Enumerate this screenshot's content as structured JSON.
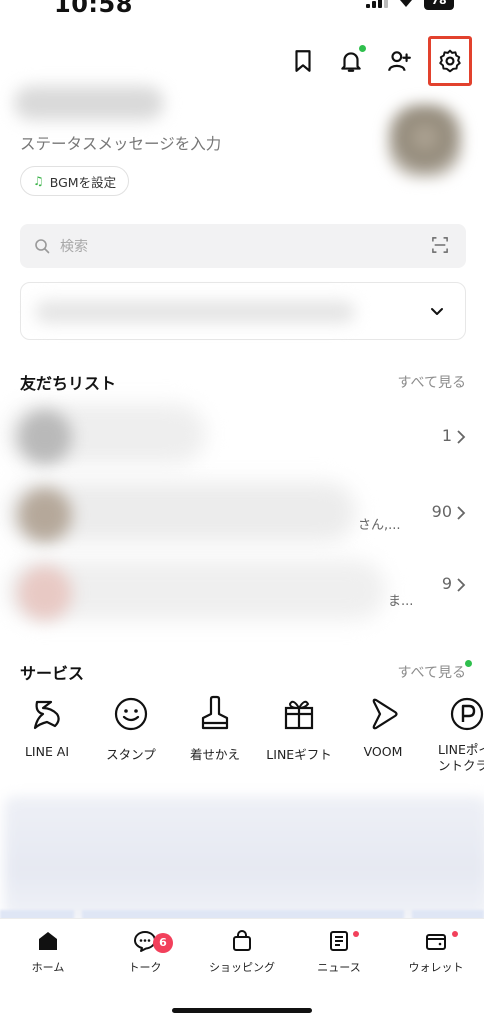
{
  "status_bar": {
    "time": "10:58",
    "battery": "78"
  },
  "profile": {
    "status_message": "ステータスメッセージを入力",
    "bgm_label": "BGMを設定"
  },
  "search": {
    "placeholder": "検索"
  },
  "friends": {
    "title": "友だちリスト",
    "see_all": "すべて見る",
    "rows": [
      {
        "snippet": "",
        "count": "1"
      },
      {
        "snippet": "さん,...",
        "count": "90"
      },
      {
        "snippet": "ま...",
        "count": "9"
      }
    ]
  },
  "services": {
    "title": "サービス",
    "see_all": "すべて見る",
    "items": [
      {
        "label": "LINE AI",
        "icon": "line-ai-icon"
      },
      {
        "label": "スタンプ",
        "icon": "smiley-icon"
      },
      {
        "label": "着せかえ",
        "icon": "brush-icon"
      },
      {
        "label": "LINEギフト",
        "icon": "gift-icon"
      },
      {
        "label": "VOOM",
        "icon": "play-icon"
      },
      {
        "label": "LINEポイントクラブ",
        "icon": "points-icon"
      }
    ]
  },
  "tabs": [
    {
      "label": "ホーム",
      "icon": "home-icon"
    },
    {
      "label": "トーク",
      "icon": "chat-icon",
      "badge": "6"
    },
    {
      "label": "ショッピング",
      "icon": "bag-icon"
    },
    {
      "label": "ニュース",
      "icon": "news-icon"
    },
    {
      "label": "ウォレット",
      "icon": "wallet-icon"
    }
  ],
  "colors": {
    "accent_green": "#2fbf4d",
    "highlight_red": "#e2412d",
    "badge_red": "#f2405b"
  }
}
